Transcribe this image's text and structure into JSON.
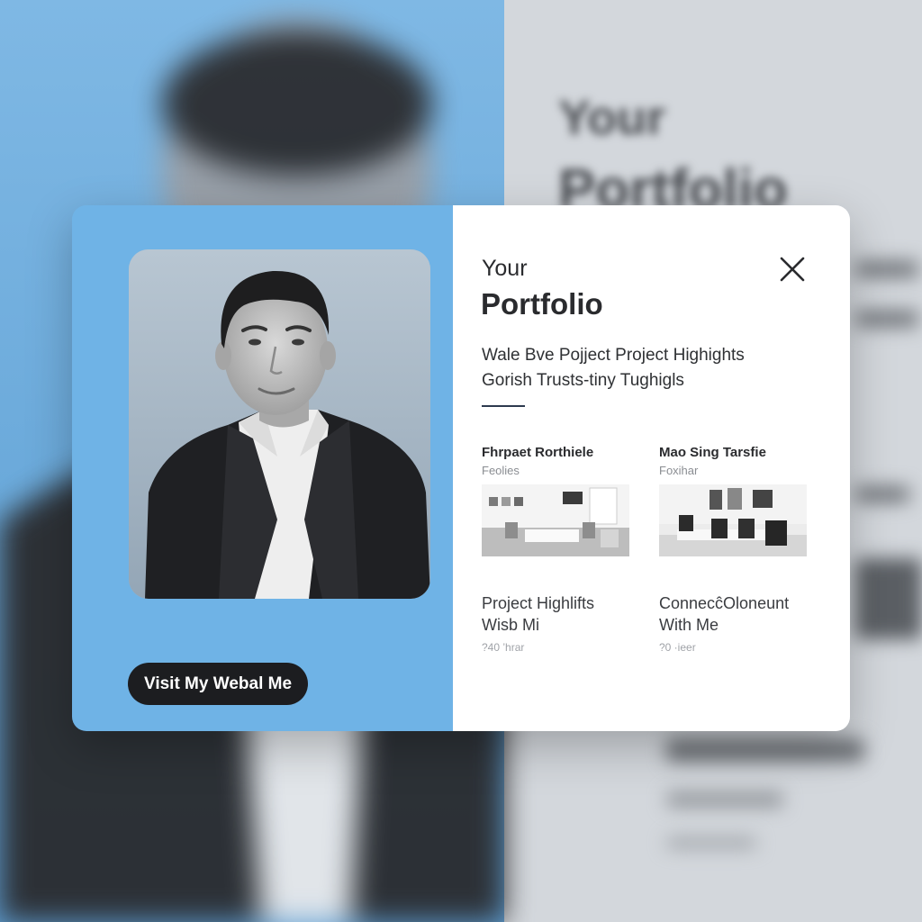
{
  "dialog": {
    "title_small": "Your",
    "title_big": "Portfolio",
    "subtitle_lines": [
      "Wale Bve Pojject Project Highights",
      "Gorish Trusts-tiny Tughigls"
    ],
    "cta_label": "Visit My Webal Me",
    "projects": [
      {
        "title": "Fhrpaet Rorthiele",
        "caption": "Feolies"
      },
      {
        "title": "Mao Sing Tarsfie",
        "caption": "Foxihar"
      }
    ],
    "links": [
      {
        "line1": "Project Highlifts",
        "line2": "Wisb Mi",
        "meta": "?40 ’hrar"
      },
      {
        "line1": "ConnecĉOloneunt",
        "line2": "With Me",
        "meta": "?0 ·ieer"
      }
    ]
  },
  "background": {
    "title_line1": "Your",
    "title_line2": "Portfolio"
  },
  "colors": {
    "accent_blue": "#6fb3e6",
    "button_dark": "#1c1d20",
    "text_dark": "#2a2b2e"
  },
  "icons": [
    "close-icon"
  ]
}
